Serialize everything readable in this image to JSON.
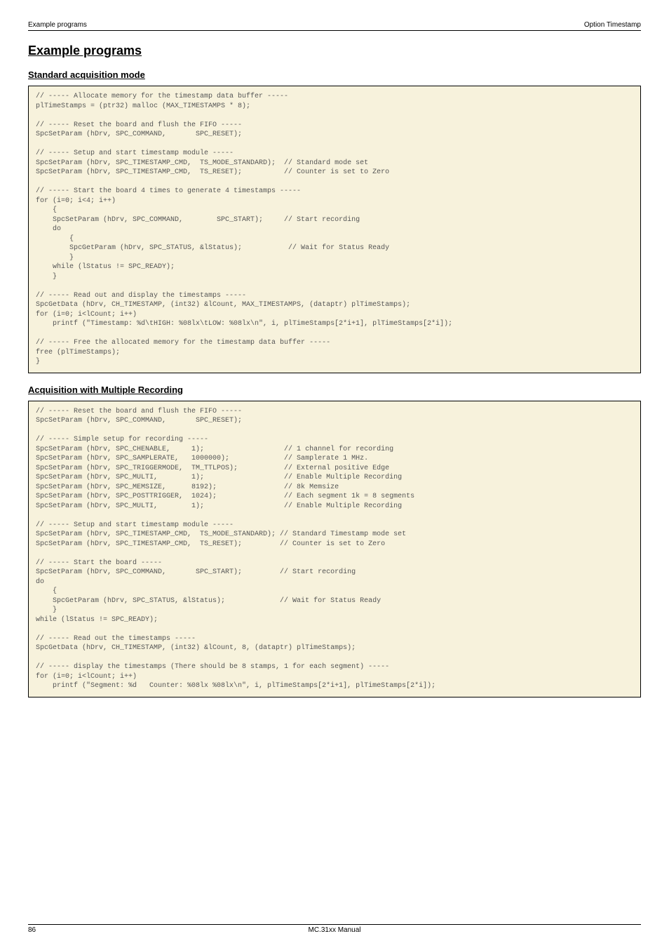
{
  "header": {
    "left": "Example programs",
    "right": "Option Timestamp"
  },
  "title": "Example programs",
  "section1": {
    "heading": "Standard acquisition mode",
    "code": "// ----- Allocate memory for the timestamp data buffer -----\nplTimeStamps = (ptr32) malloc (MAX_TIMESTAMPS * 8);\n\n// ----- Reset the board and flush the FIFO -----\nSpcSetParam (hDrv, SPC_COMMAND,       SPC_RESET);\n\n// ----- Setup and start timestamp module -----\nSpcSetParam (hDrv, SPC_TIMESTAMP_CMD,  TS_MODE_STANDARD);  // Standard mode set\nSpcSetParam (hDrv, SPC_TIMESTAMP_CMD,  TS_RESET);          // Counter is set to Zero\n\n// ----- Start the board 4 times to generate 4 timestamps -----\nfor (i=0; i<4; i++)\n    {\n    SpcSetParam (hDrv, SPC_COMMAND,        SPC_START);     // Start recording\n    do\n        {\n        SpcGetParam (hDrv, SPC_STATUS, &lStatus);           // Wait for Status Ready\n        }\n    while (lStatus != SPC_READY);\n    }\n\n// ----- Read out and display the timestamps -----\nSpcGetData (hDrv, CH_TIMESTAMP, (int32) &lCount, MAX_TIMESTAMPS, (dataptr) plTimeStamps);\nfor (i=0; i<lCount; i++)\n    printf (\"Timestamp: %d\\tHIGH: %08lx\\tLOW: %08lx\\n\", i, plTimeStamps[2*i+1], plTimeStamps[2*i]);\n\n// ----- Free the allocated memory for the timestamp data buffer -----\nfree (plTimeStamps);\n}"
  },
  "section2": {
    "heading": "Acquisition with Multiple Recording",
    "code": "// ----- Reset the board and flush the FIFO -----\nSpcSetParam (hDrv, SPC_COMMAND,       SPC_RESET);\n\n// ----- Simple setup for recording -----\nSpcSetParam (hDrv, SPC_CHENABLE,     1);                   // 1 channel for recording\nSpcSetParam (hDrv, SPC_SAMPLERATE,   1000000);             // Samplerate 1 MHz.\nSpcSetParam (hDrv, SPC_TRIGGERMODE,  TM_TTLPOS);           // External positive Edge\nSpcSetParam (hDrv, SPC_MULTI,        1);                   // Enable Multiple Recording\nSpcSetParam (hDrv, SPC_MEMSIZE,      8192);                // 8k Memsize\nSpcSetParam (hDrv, SPC_POSTTRIGGER,  1024);                // Each segment 1k = 8 segments\nSpcSetParam (hDrv, SPC_MULTI,        1);                   // Enable Multiple Recording\n\n// ----- Setup and start timestamp module -----\nSpcSetParam (hDrv, SPC_TIMESTAMP_CMD,  TS_MODE_STANDARD); // Standard Timestamp mode set\nSpcSetParam (hDrv, SPC_TIMESTAMP_CMD,  TS_RESET);         // Counter is set to Zero\n\n// ----- Start the board -----\nSpcSetParam (hDrv, SPC_COMMAND,       SPC_START);         // Start recording\ndo\n    {\n    SpcGetParam (hDrv, SPC_STATUS, &lStatus);             // Wait for Status Ready\n    }\nwhile (lStatus != SPC_READY);\n\n// ----- Read out the timestamps -----\nSpcGetData (hDrv, CH_TIMESTAMP, (int32) &lCount, 8, (dataptr) plTimeStamps);\n\n// ----- display the timestamps (There should be 8 stamps, 1 for each segment) -----\nfor (i=0; i<lCount; i++)\n    printf (\"Segment: %d   Counter: %08lx %08lx\\n\", i, plTimeStamps[2*i+1], plTimeStamps[2*i]);"
  },
  "footer": {
    "page": "86",
    "center": "MC.31xx Manual"
  }
}
